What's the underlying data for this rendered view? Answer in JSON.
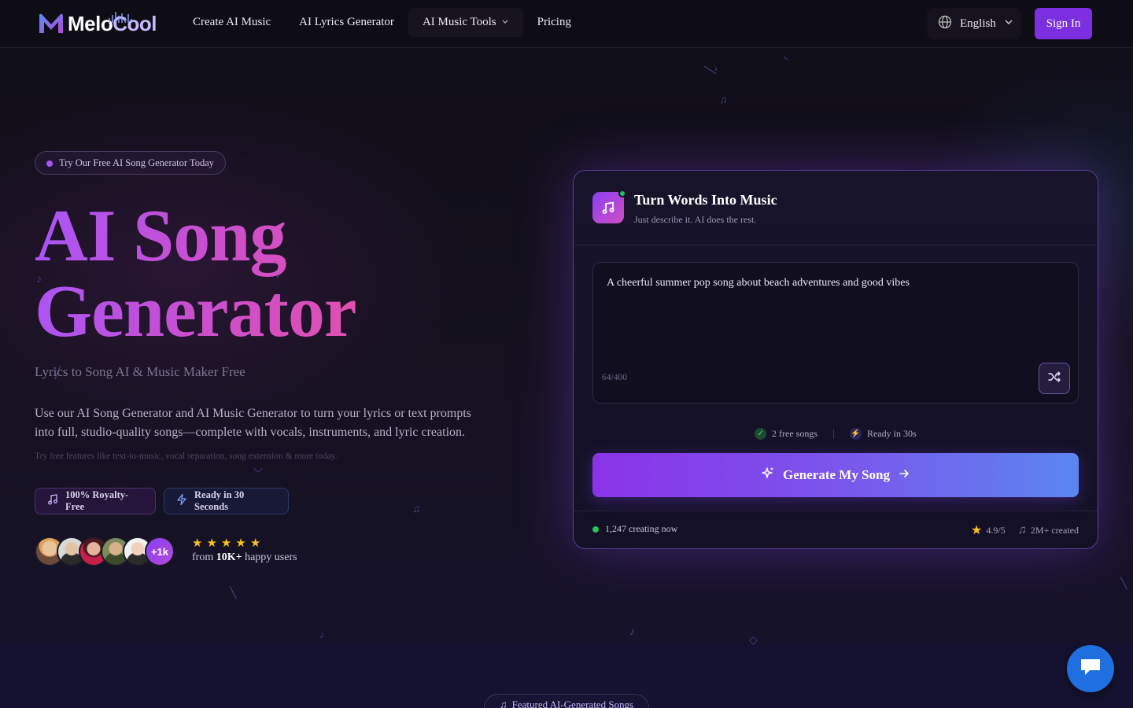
{
  "brand": {
    "logo_text_a": "Melo",
    "logo_text_b": "Cool",
    "colors": {
      "accent": "#7b2fe0",
      "pink": "#ee4fa0",
      "blue": "#5b86f0"
    }
  },
  "nav": {
    "items": [
      {
        "label": "Create AI Music"
      },
      {
        "label": "AI Lyrics Generator"
      },
      {
        "label": "AI Music Tools",
        "has_dropdown": true
      },
      {
        "label": "Pricing"
      }
    ],
    "language": "English",
    "sign_in": "Sign In"
  },
  "hero": {
    "pill": "Try Our Free AI Song Generator Today",
    "title_line1": "AI Song",
    "title_line2": "Generator",
    "subtitle": "Lyrics to Song AI & Music Maker Free",
    "description": "Use our AI Song Generator and AI Music Generator to turn your lyrics or text prompts into full, studio-quality songs—complete with vocals, instruments, and lyric creation.",
    "note": "Try free features like text-to-music, vocal separation, song extension & more today.",
    "badges": [
      {
        "label": "100% Royalty-Free",
        "icon": "music-note-icon"
      },
      {
        "label": "Ready in 30 Seconds",
        "icon": "lightning-icon"
      }
    ],
    "avatars_more": "+1k",
    "rating_stars": 5,
    "users_prefix": "from",
    "users_count": "10K+",
    "users_suffix": "happy users"
  },
  "card": {
    "title": "Turn Words Into Music",
    "subtitle": "Just describe it. AI does the rest.",
    "prompt": "A cheerful summer pop song about beach adventures and good vibes",
    "counter": "64/400",
    "free_songs": "2 free songs",
    "ready": "Ready in 30s",
    "generate": "Generate My Song",
    "creating_now": "1,247 creating now",
    "rating": "4.9/5",
    "created": "2M+ created"
  },
  "featured": {
    "label": "Featured AI-Generated Songs"
  }
}
